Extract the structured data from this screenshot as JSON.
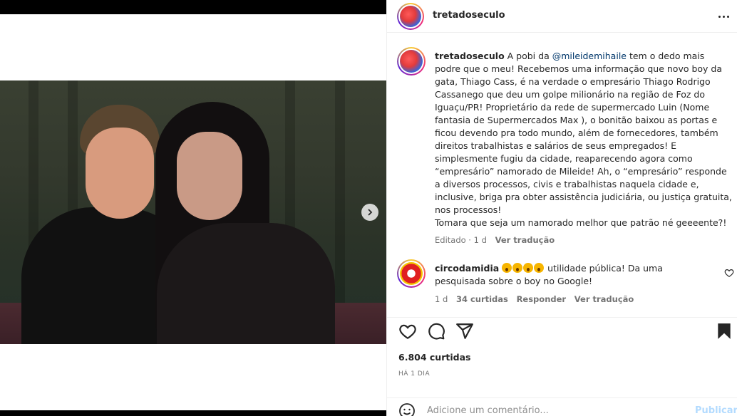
{
  "post": {
    "username": "tretadoseculo",
    "caption_lines": [
      {
        "pre": "",
        "user": "tretadoseculo",
        "text1": " A pobi da ",
        "mention": "@mileidemihaile",
        "text2": " tem o dedo mais"
      },
      "podre que o meu! Recebemos uma informação que novo boy da",
      "gata, Thiago Cass, é na verdade o empresário Thiago Rodrigo",
      "Cassanego que deu um golpe milionário na região de Foz do",
      "Iguaçu/PR! Proprietário da rede de supermercado Luin (Nome",
      "fantasia de Supermercados Max ), o bonitão baixou as portas e",
      "ficou devendo pra todo mundo, além de fornecedores, também",
      "direitos trabalhistas e salários de seus empregados! E",
      "simplesmente fugiu da cidade, reaparecendo agora como",
      "“empresário” namorado de Mileide! Ah, o “empresário” responde",
      "a diversos processos, civis e trabalhistas naquela cidade e,",
      "inclusive, briga pra obter assistência judiciária, ou justiça gratuita,",
      "nos processos!",
      "Tomara que seja um namorado melhor que patrão né geeeente?!"
    ],
    "edited": "Editado · 1 d",
    "see_translation": "Ver tradução",
    "likes": "6.804 curtidas",
    "date": "HÁ 1 DIA"
  },
  "comment": {
    "username": "circodamidia",
    "emojis": [
      "astonished",
      "astonished",
      "astonished",
      "astonished"
    ],
    "text_line1": " utilidade pública! Da uma",
    "text_line2": "pesquisada sobre o boy no Google!",
    "age": "1 d",
    "likes": "34 curtidas",
    "reply": "Responder",
    "see_translation": "Ver tradução"
  },
  "add_comment": {
    "placeholder": "Adicione um comentário...",
    "publish": "Publicar"
  },
  "icons": {
    "like": "heart-icon",
    "comment": "comment-icon",
    "share": "share-icon",
    "save": "bookmark-icon",
    "more": "more-icon",
    "next": "chevron-right-icon",
    "emoji": "smile-icon"
  },
  "colors": {
    "text": "#262626",
    "muted": "#737373",
    "mention": "#00376b",
    "publish_disabled": "#b3dbff"
  }
}
